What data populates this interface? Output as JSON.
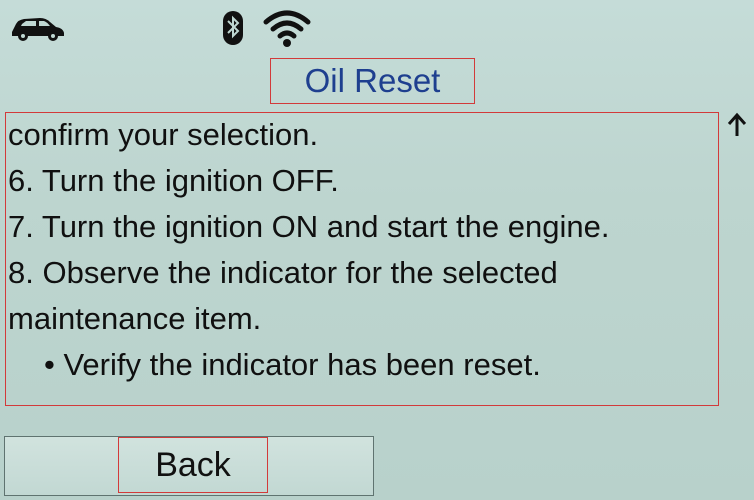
{
  "status_bar": {
    "icons": [
      "car-icon",
      "bluetooth-icon",
      "wifi-icon"
    ]
  },
  "screen": {
    "title": "Oil Reset"
  },
  "content": {
    "lines": [
      "confirm your selection.",
      "6. Turn the ignition OFF.",
      "7. Turn the ignition ON and start the engine.",
      "8. Observe the indicator for the selected",
      "maintenance item.",
      "• Verify the indicator has been reset."
    ],
    "scroll_indicator": "↑"
  },
  "footer": {
    "back_label": "Back"
  },
  "colors": {
    "title": "#1e3f8f",
    "highlight_border": "#d23a3a",
    "background": "#bfd7d2"
  }
}
